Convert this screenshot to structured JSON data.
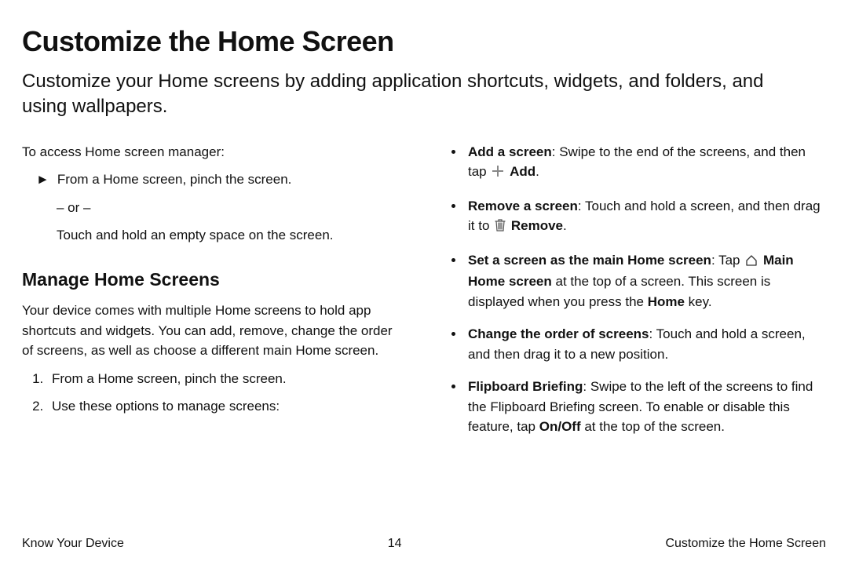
{
  "title": "Customize the Home Screen",
  "intro": "Customize your Home screens by adding application shortcuts, widgets, and folders, and using wallpapers.",
  "left": {
    "access_intro": "To access Home screen manager:",
    "pinch": "From a Home screen, pinch the screen.",
    "or": "– or –",
    "hold": "Touch and hold an empty space on the screen.",
    "manage_heading": "Manage Home Screens",
    "manage_desc": "Your device comes with multiple Home screens to hold app shortcuts and widgets. You can add, remove, change the order of screens, as well as choose a different main Home screen.",
    "step1": "From a Home screen, pinch the screen.",
    "step2": "Use these options to manage screens:"
  },
  "bullets": {
    "add_label": "Add a screen",
    "add_text1": ": Swipe to the end of the screens, and then tap ",
    "add_bold": "Add",
    "add_text2": ".",
    "remove_label": "Remove a screen",
    "remove_text1": ": Touch and hold a screen, and then drag it to ",
    "remove_bold": "Remove",
    "remove_text2": ".",
    "main_label": "Set a screen as the main Home screen",
    "main_text1": ": Tap ",
    "main_bold1": "Main Home screen",
    "main_text2": " at the top of a screen. This screen is displayed when you press the ",
    "main_bold2": "Home",
    "main_text3": " key.",
    "order_label": "Change the order of screens",
    "order_text": ": Touch and hold a screen, and then drag it to a new position.",
    "flip_label": "Flipboard Briefing",
    "flip_text1": ": Swipe to the left of the screens to find the Flipboard Briefing screen. To enable or disable this feature, tap ",
    "flip_bold": "On/Off",
    "flip_text2": " at the top of the screen."
  },
  "footer": {
    "left": "Know Your Device",
    "page": "14",
    "right": "Customize the Home Screen"
  }
}
